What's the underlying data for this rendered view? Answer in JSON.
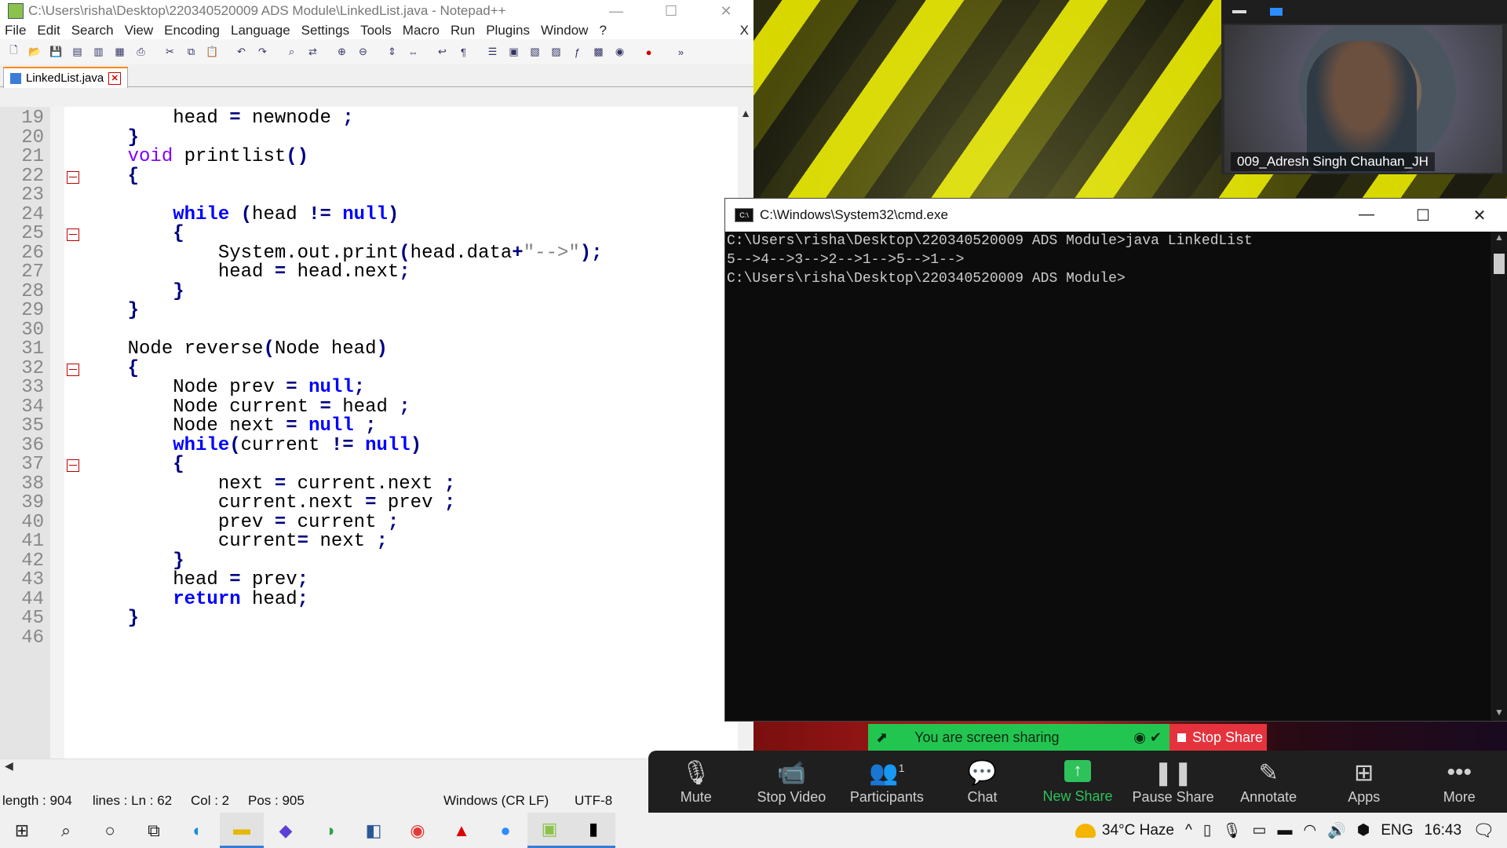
{
  "notepad": {
    "title": "C:\\Users\\risha\\Desktop\\220340520009 ADS Module\\LinkedList.java - Notepad++",
    "menu": [
      "File",
      "Edit",
      "Search",
      "View",
      "Encoding",
      "Language",
      "Settings",
      "Tools",
      "Macro",
      "Run",
      "Plugins",
      "Window",
      "?"
    ],
    "menu_close": "X",
    "tab_label": "LinkedList.java",
    "tab_close": "✕",
    "lines": [
      {
        "n": "19",
        "code": "        head = newnode ;"
      },
      {
        "n": "20",
        "code": "    }"
      },
      {
        "n": "21",
        "code": "    void printlist()"
      },
      {
        "n": "22",
        "code": "    {"
      },
      {
        "n": "23",
        "code": ""
      },
      {
        "n": "24",
        "code": "        while (head != null)"
      },
      {
        "n": "25",
        "code": "        {"
      },
      {
        "n": "26",
        "code": "            System.out.print(head.data+\"-->\");"
      },
      {
        "n": "27",
        "code": "            head = head.next;"
      },
      {
        "n": "28",
        "code": "        }"
      },
      {
        "n": "29",
        "code": "    }"
      },
      {
        "n": "30",
        "code": ""
      },
      {
        "n": "31",
        "code": "    Node reverse(Node head)"
      },
      {
        "n": "32",
        "code": "    {"
      },
      {
        "n": "33",
        "code": "        Node prev = null;"
      },
      {
        "n": "34",
        "code": "        Node current = head ;"
      },
      {
        "n": "35",
        "code": "        Node next = null ;"
      },
      {
        "n": "36",
        "code": "        while(current != null)"
      },
      {
        "n": "37",
        "code": "        {"
      },
      {
        "n": "38",
        "code": "            next = current.next ;"
      },
      {
        "n": "39",
        "code": "            current.next = prev ;"
      },
      {
        "n": "40",
        "code": "            prev = current ;"
      },
      {
        "n": "41",
        "code": "            current= next ;"
      },
      {
        "n": "42",
        "code": "        }"
      },
      {
        "n": "43",
        "code": "        head = prev;"
      },
      {
        "n": "44",
        "code": "        return head;"
      },
      {
        "n": "45",
        "code": "    }"
      },
      {
        "n": "46",
        "code": ""
      }
    ],
    "status": {
      "length": "length : 904",
      "lines": "lines : Ln : 62",
      "col": "Col : 2",
      "pos": "Pos : 905",
      "eol": "Windows (CR LF)",
      "encoding": "UTF-8"
    }
  },
  "zoom_video": {
    "participant_name": "009_Adresh Singh Chauhan_JH"
  },
  "cmd": {
    "title": "C:\\Windows\\System32\\cmd.exe",
    "lines": [
      "C:\\Users\\risha\\Desktop\\220340520009 ADS Module>java LinkedList",
      "5-->4-->3-->2-->1-->5-->1-->",
      "C:\\Users\\risha\\Desktop\\220340520009 ADS Module>"
    ]
  },
  "share_banner": {
    "text": "You are screen sharing",
    "stop_label": "Stop Share"
  },
  "zoom_toolbar": {
    "items": [
      {
        "label": "Mute",
        "icon": "microphone-icon"
      },
      {
        "label": "Stop Video",
        "icon": "video-camera-icon"
      },
      {
        "label": "Participants",
        "icon": "participants-icon",
        "badge": "1"
      },
      {
        "label": "Chat",
        "icon": "chat-icon"
      },
      {
        "label": "New Share",
        "icon": "share-arrow-icon"
      },
      {
        "label": "Pause Share",
        "icon": "pause-icon"
      },
      {
        "label": "Annotate",
        "icon": "pencil-icon"
      },
      {
        "label": "Apps",
        "icon": "apps-icon"
      },
      {
        "label": "More",
        "icon": "more-icon"
      }
    ],
    "accent": "#2ec25b"
  },
  "taskbar": {
    "weather": "34°C  Haze",
    "language": "ENG",
    "time": "16:43"
  },
  "colors": {
    "keyword": "#0000ff",
    "type_keyword": "#8000ff",
    "share_green": "#23c551",
    "stop_red": "#e5333d"
  }
}
